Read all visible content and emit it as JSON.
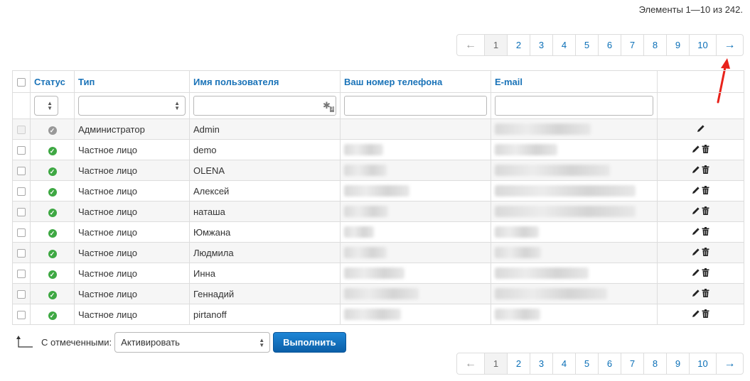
{
  "summary": "Элементы 1—10 из 242.",
  "pagination": {
    "prev": "←",
    "next": "→",
    "pages": [
      "1",
      "2",
      "3",
      "4",
      "5",
      "6",
      "7",
      "8",
      "9",
      "10"
    ],
    "active": "1"
  },
  "table": {
    "headers": {
      "status": "Статус",
      "type": "Тип",
      "username": "Имя пользователя",
      "phone": "Ваш номер телефона",
      "email": "E-mail"
    },
    "rows": [
      {
        "type": "Администратор",
        "username": "Admin"
      },
      {
        "type": "Частное лицо",
        "username": "demo"
      },
      {
        "type": "Частное лицо",
        "username": "OLENA"
      },
      {
        "type": "Частное лицо",
        "username": "Алексей"
      },
      {
        "type": "Частное лицо",
        "username": "наташа"
      },
      {
        "type": "Частное лицо",
        "username": "Юмжана"
      },
      {
        "type": "Частное лицо",
        "username": "Людмила"
      },
      {
        "type": "Частное лицо",
        "username": "Инна"
      },
      {
        "type": "Частное лицо",
        "username": "Геннадий"
      },
      {
        "type": "Частное лицо",
        "username": "pirtanoff"
      }
    ]
  },
  "bulk": {
    "label": "С отмеченными:",
    "selected": "Активировать",
    "button": "Выполнить"
  },
  "colors": {
    "link": "#0a6fb7",
    "header": "#1a73b8",
    "button": "#0b5fa8",
    "annotation": "#e8221b",
    "status_ok": "#3ea843"
  }
}
